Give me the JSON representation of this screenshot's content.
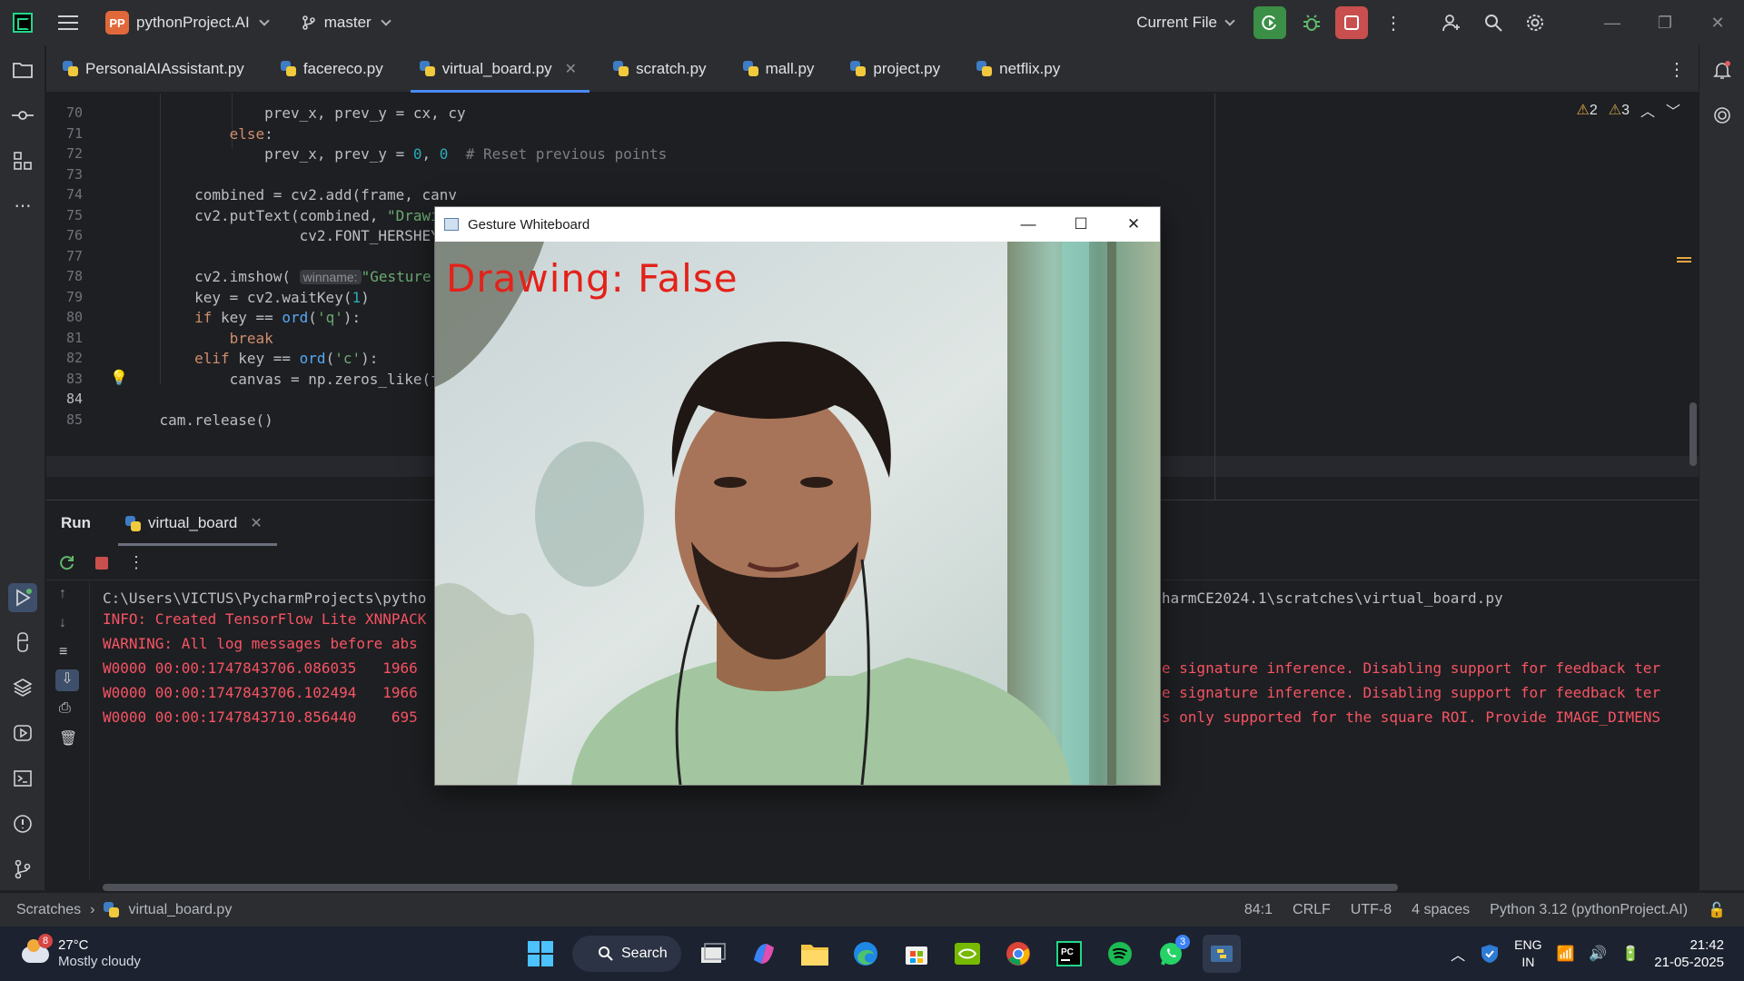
{
  "titlebar": {
    "project_badge": "PP",
    "project_name": "pythonProject.AI",
    "branch": "master",
    "run_config": "Current File"
  },
  "tabs": [
    {
      "label": "PersonalAIAssistant.py"
    },
    {
      "label": "facereco.py"
    },
    {
      "label": "virtual_board.py",
      "active": true
    },
    {
      "label": "scratch.py"
    },
    {
      "label": "mall.py"
    },
    {
      "label": "project.py"
    },
    {
      "label": "netflix.py"
    }
  ],
  "editor": {
    "warnings_a": "2",
    "warnings_b": "3",
    "lines": [
      {
        "no": "70",
        "code": "                prev_x, prev_y = cx, cy"
      },
      {
        "no": "71",
        "code": "            else:"
      },
      {
        "no": "72",
        "code": "                prev_x, prev_y = 0, 0  # Reset previous points"
      },
      {
        "no": "73",
        "code": ""
      },
      {
        "no": "74",
        "code": "        combined = cv2.add(frame, canv"
      },
      {
        "no": "75",
        "code": "        cv2.putText(combined, \"Drawing"
      },
      {
        "no": "76",
        "code": "                    cv2.FONT_HERSHEY_S"
      },
      {
        "no": "77",
        "code": ""
      },
      {
        "no": "78",
        "code": "        cv2.imshow("
      },
      {
        "no": "79",
        "code": "        key = cv2.waitKey(1)"
      },
      {
        "no": "80",
        "code": "        if key == ord('q'):"
      },
      {
        "no": "81",
        "code": "            break"
      },
      {
        "no": "82",
        "code": "        elif key == ord('c'):"
      },
      {
        "no": "83",
        "code": "            canvas = np.zeros_like(fra"
      },
      {
        "no": "84",
        "code": ""
      },
      {
        "no": "85",
        "code": "    cam.release()"
      }
    ],
    "hint_winname": "winname:",
    "imshow_arg": "\"Gesture Wh"
  },
  "run_panel": {
    "title": "Run",
    "tab_label": "virtual_board",
    "console": [
      {
        "text": "C:\\Users\\VICTUS\\PycharmProjects\\pytho",
        "tail": "PyCharmCE2024.1\\scratches\\virtual_board.py",
        "color": "white"
      },
      {
        "text": "INFO: Created TensorFlow Lite XNNPACK",
        "tail": "",
        "color": "red"
      },
      {
        "text": "WARNING: All log messages before abs",
        "tail": "",
        "color": "red"
      },
      {
        "text": "W0000 00:00:1747843706.086035   1966",
        "tail": "ngle signature inference. Disabling support for feedback ter",
        "color": "red"
      },
      {
        "text": "W0000 00:00:1747843706.102494   1966",
        "tail": "ngle signature inference. Disabling support for feedback ter",
        "color": "red"
      },
      {
        "text": "W0000 00:00:1747843710.856440    695",
        "tail": "S is only supported for the square ROI. Provide IMAGE_DIMENS",
        "color": "red"
      }
    ]
  },
  "statusbar": {
    "breadcrumb_root": "Scratches",
    "breadcrumb_file": "virtual_board.py",
    "position": "84:1",
    "line_sep": "CRLF",
    "encoding": "UTF-8",
    "indent": "4 spaces",
    "interpreter": "Python 3.12 (pythonProject.AI)"
  },
  "gesture_window": {
    "title": "Gesture Whiteboard",
    "overlay_text": "Drawing: False"
  },
  "taskbar": {
    "weather_badge": "8",
    "temperature": "27°C",
    "condition": "Mostly cloudy",
    "search_label": "Search",
    "whatsapp_badge": "3",
    "lang_top": "ENG",
    "lang_bottom": "IN",
    "time": "21:42",
    "date": "21-05-2025"
  },
  "colors": {
    "ide_bg": "#1e1f22",
    "panel_bg": "#2b2d30",
    "accent_blue": "#4a8af4",
    "error_red": "#f75464",
    "overlay_red": "#e3221a"
  }
}
